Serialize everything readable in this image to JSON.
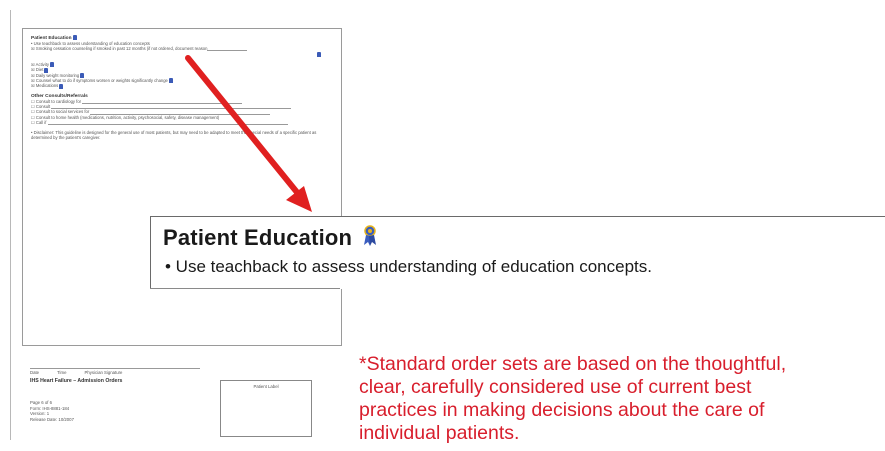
{
  "callout": {
    "title": "Patient Education",
    "bullet": "• Use teachback to assess understanding of education concepts."
  },
  "disclaimer": {
    "lines": [
      "*Standard order sets are based on the thoughtful,",
      "clear, carefully considered use of current best",
      "practices in making decisions about the care of",
      "individual patients."
    ]
  },
  "thumbnail": {
    "education_heading": "Patient Education",
    "education_items": [
      "• Use teachback to assess understanding of education concepts",
      "☒ Smoking cessation counseling if smoked in past 12 months (if not ordered, document reason",
      "☒ Activity",
      "☒ Diet",
      "☒ Daily weight monitoring",
      "☒ Counsel what to do if symptoms worsen or weights significantly change",
      "☒ Medications"
    ],
    "consults_heading": "Other Consults/Referrals",
    "consult_items": [
      "☐ Consult to cardiology for",
      "☐ Consult",
      "☐ Consult to social services for",
      "☐ Consult to home health (medications, nutrition, activity, psychosocial, safety, disease management)",
      "☐ Call if"
    ],
    "disclaimer_text": "• Disclaimer: This guideline is designed for the general use of most patients, but may need to be adapted to meet the special needs of a specific patient as determined by the patient's caregiver."
  },
  "footer": {
    "sig_labels": [
      "Date",
      "Time",
      "Physician Signature"
    ],
    "title": "IHS Heart Failure – Admission Orders",
    "meta": [
      "Page 6 of 6",
      "Form: IHS-8881-184",
      "Version: 1",
      "Release Date: 10/2007"
    ],
    "label_box": "Patient Label"
  },
  "colors": {
    "arrow": "#e02020",
    "disclaimer": "#d81e2c",
    "ribbon_blue": "#3a5dbf",
    "ribbon_gold": "#e7b419"
  },
  "icons": {
    "award": "award-ribbon-icon",
    "arrow": "red-pointer-arrow"
  }
}
